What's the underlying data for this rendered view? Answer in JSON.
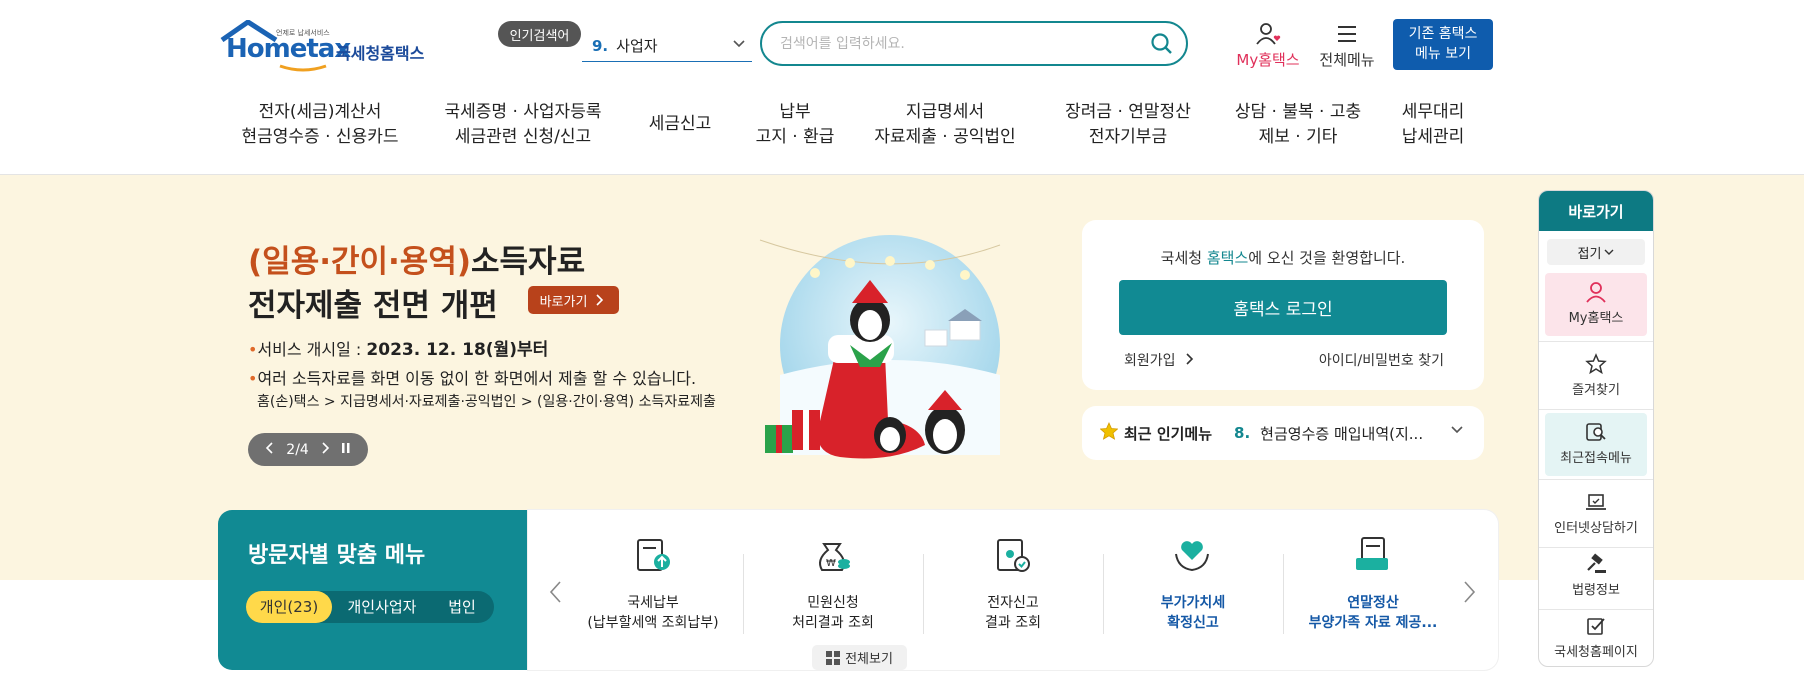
{
  "header": {
    "logo": {
      "tagline": "언제로 납세서비스",
      "brand": "Hometax",
      "name_ko": "국세청홈택스"
    },
    "popular_badge": "인기검색어",
    "popular_select": {
      "rank": "9.",
      "value": "사업자"
    },
    "search": {
      "placeholder": "검색어를 입력하세요."
    },
    "my_hometax": "My홈택스",
    "all_menu": "전체메뉴",
    "legacy": {
      "line1": "기존 홈택스",
      "line2": "메뉴 보기"
    }
  },
  "gnb": [
    {
      "l1": "전자(세금)계산서",
      "l2": "현금영수증 · 신용카드"
    },
    {
      "l1": "국세증명 · 사업자등록",
      "l2": "세금관련 신청/신고"
    },
    {
      "l1": "세금신고",
      "l2": ""
    },
    {
      "l1": "납부",
      "l2": "고지 · 환급"
    },
    {
      "l1": "지급명세서",
      "l2": "자료제출 · 공익법인"
    },
    {
      "l1": "장려금 · 연말정산",
      "l2": "전자기부금"
    },
    {
      "l1": "상담 · 불복 · 고충",
      "l2": "제보 · 기타"
    },
    {
      "l1": "세무대리",
      "l2": "납세관리"
    }
  ],
  "banner": {
    "title_highlight": "(일용·간이·용역)",
    "title_rest": "소득자료",
    "title_line2": "전자제출 전면 개편",
    "go_button": "바로가기",
    "line1_label": "서비스 개시일 : ",
    "line1_value": "2023. 12. 18(월)부터",
    "line2": "여러 소득자료를 화면 이동 없이 한 화면에서 제출 할 수 있습니다.",
    "line3": "홈(손)택스 > 지급명세서·자료제출·공익법인 > (일용·간이·용역) 소득자료제출",
    "slide": "2/4"
  },
  "login": {
    "welcome_pre": "국세청 ",
    "welcome_brand": "홈택스",
    "welcome_post": "에 오신 것을 환영합니다.",
    "login_button": "홈택스 로그인",
    "signup": "회원가입",
    "find_id": "아이디/비밀번호 찾기"
  },
  "recent_popular": {
    "title": "최근 인기메뉴",
    "rank": "8.",
    "value": "현금영수증 매입내역(지..."
  },
  "visitor": {
    "title": "방문자별 맞춤 메뉴",
    "tabs": [
      "개인(23)",
      "개인사업자",
      "법인"
    ]
  },
  "quick_menu": [
    {
      "l1": "국세납부",
      "l2": "(납부할세액 조회납부)",
      "icon": "tax-payment-icon"
    },
    {
      "l1": "민원신청",
      "l2": "처리결과 조회",
      "icon": "money-bag-icon"
    },
    {
      "l1": "전자신고",
      "l2": "결과 조회",
      "icon": "e-filing-icon"
    },
    {
      "l1": "부가가치세",
      "l2": "확정신고",
      "icon": "heart-hands-icon"
    },
    {
      "l1": "연말정산",
      "l2": "부양가족 자료 제공...",
      "icon": "document-tray-icon"
    }
  ],
  "view_all": "전체보기",
  "quickbar": {
    "title": "바로가기",
    "fold": "접기",
    "items": [
      "My홈택스",
      "즐겨찾기",
      "최근접속메뉴",
      "인터넷상담하기",
      "법령정보",
      "국세청홈페이지"
    ]
  },
  "colors": {
    "teal": "#118a93",
    "brand_blue": "#0f5cad",
    "banner_bg": "#fcf5e0",
    "accent_orange": "#b8421b"
  }
}
